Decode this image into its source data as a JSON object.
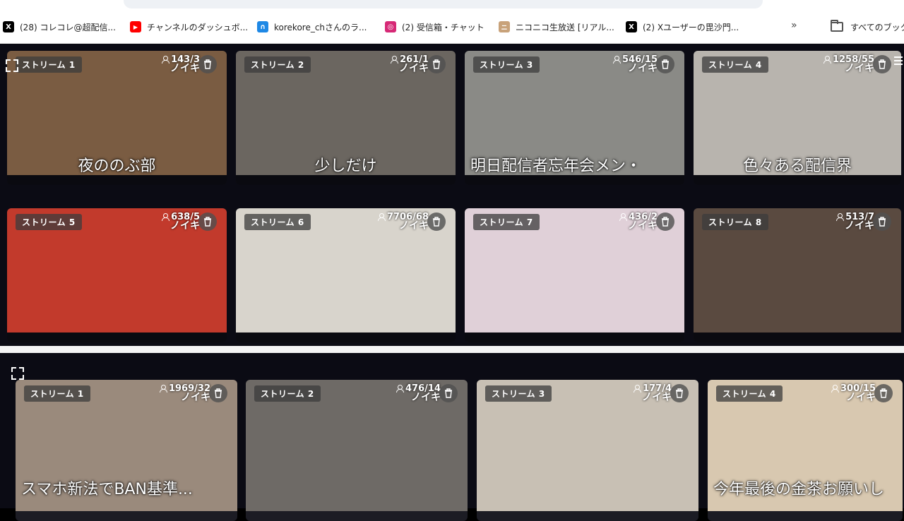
{
  "bookmarks": [
    {
      "icon": "x-icon",
      "label": "(28) コレコレ@超配信...",
      "color": "#000000",
      "glyph": "X"
    },
    {
      "icon": "youtube-icon",
      "label": "チャンネルのダッシュボ...",
      "color": "#ff0000",
      "glyph": "▶"
    },
    {
      "icon": "headset-icon",
      "label": "korekore_chさんのラ...",
      "color": "#1e88e5",
      "glyph": "∩"
    },
    {
      "icon": "instagram-icon",
      "label": "(2) 受信箱・チャット",
      "color": "#d62976",
      "glyph": "◎"
    },
    {
      "icon": "niconico-icon",
      "label": "ニコニコ生放送 [リアル...",
      "color": "#c8a27a",
      "glyph": "ニ"
    },
    {
      "icon": "x-icon",
      "label": "(2) Xユーザーの毘沙門...",
      "color": "#000000",
      "glyph": "X"
    }
  ],
  "more_label": "»",
  "all_bookmarks_label": "すべてのブック",
  "top_panel": {
    "tiles": [
      {
        "label": "ストリーム 1",
        "viewers": "143/3",
        "noiki": "ノイキ",
        "caption": "夜ののぶ部",
        "bg": "#7a5c42"
      },
      {
        "label": "ストリーム 2",
        "viewers": "261/1",
        "noiki": "ノイキ",
        "caption": "少しだけ",
        "bg": "#6b6660"
      },
      {
        "label": "ストリーム 3",
        "viewers": "546/15",
        "noiki": "ノイキ",
        "caption": "明日配信者忘年会メン・",
        "bg": "#8a8a86"
      },
      {
        "label": "ストリーム 4",
        "viewers": "1258/55",
        "noiki": "ノイキ",
        "caption": "色々ある配信界",
        "bg": "#b8b4ae"
      },
      {
        "label": "ストリーム 5",
        "viewers": "638/5",
        "noiki": "ノイキ",
        "caption": "",
        "bg": "#c23a2c"
      },
      {
        "label": "ストリーム 6",
        "viewers": "7706/68",
        "noiki": "ノイキ",
        "caption": "",
        "bg": "#d8d4cc"
      },
      {
        "label": "ストリーム 7",
        "viewers": "436/2",
        "noiki": "ノイキ",
        "caption": "",
        "bg": "#e0d0d8"
      },
      {
        "label": "ストリーム 8",
        "viewers": "513/7",
        "noiki": "ノイキ",
        "caption": "",
        "bg": "#5a4a40"
      }
    ]
  },
  "bottom_panel": {
    "tiles": [
      {
        "label": "ストリーム 1",
        "viewers": "1969/32",
        "noiki": "ノイキ",
        "caption": "スマホ新法でBAN基準...",
        "bg": "#9a8a7c"
      },
      {
        "label": "ストリーム 2",
        "viewers": "476/14",
        "noiki": "ノイキ",
        "caption": "",
        "bg": "#6e6a66"
      },
      {
        "label": "ストリーム 3",
        "viewers": "177/4",
        "noiki": "ノイキ",
        "caption": "",
        "bg": "#c8c0b4"
      },
      {
        "label": "ストリーム 4",
        "viewers": "300/15",
        "noiki": "ノイキ",
        "caption": "今年最後の金茶お願いし",
        "bg": "#d8c8b0"
      }
    ]
  }
}
